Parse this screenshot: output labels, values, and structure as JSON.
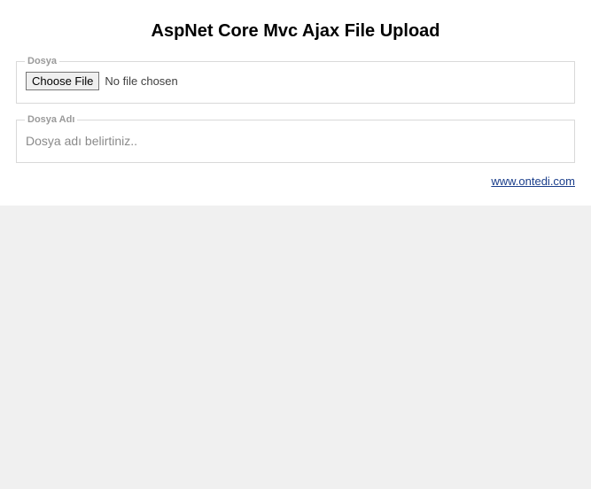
{
  "page": {
    "title": "AspNet Core Mvc Ajax File Upload"
  },
  "fileSection": {
    "legend": "Dosya",
    "button_label": "Choose File",
    "status_text": "No file chosen"
  },
  "nameSection": {
    "legend": "Dosya Adı",
    "placeholder": "Dosya adı belirtiniz..",
    "value": ""
  },
  "footer": {
    "link_text": "www.ontedi.com"
  }
}
